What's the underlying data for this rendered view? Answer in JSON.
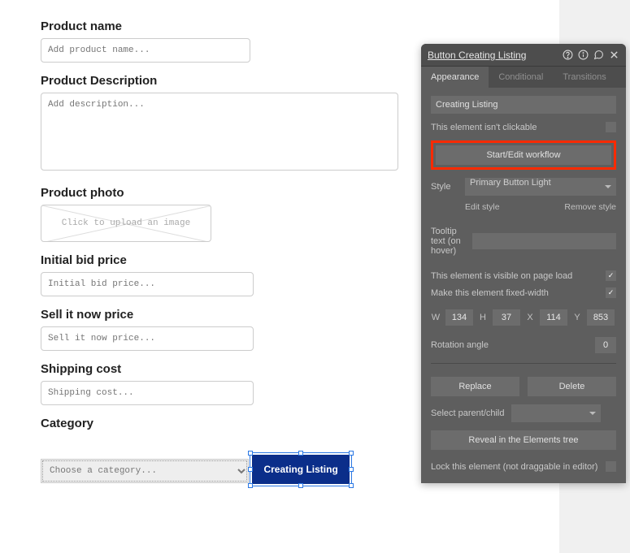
{
  "form": {
    "productName": {
      "label": "Product name",
      "placeholder": "Add product name..."
    },
    "productDescription": {
      "label": "Product Description",
      "placeholder": "Add description..."
    },
    "productPhoto": {
      "label": "Product photo",
      "text": "Click to upload an image"
    },
    "initialBid": {
      "label": "Initial bid price",
      "placeholder": "Initial bid price..."
    },
    "sellNow": {
      "label": "Sell it now price",
      "placeholder": "Sell it now price..."
    },
    "shipping": {
      "label": "Shipping cost",
      "placeholder": "Shipping cost..."
    },
    "category": {
      "label": "Category",
      "placeholder": "Choose a category..."
    },
    "createButton": "Creating Listing"
  },
  "panel": {
    "title": "Button Creating Listing",
    "tabs": {
      "appearance": "Appearance",
      "conditional": "Conditional",
      "transitions": "Transitions"
    },
    "elementName": "Creating Listing",
    "notClickable": "This element isn't clickable",
    "workflowBtn": "Start/Edit workflow",
    "styleLabel": "Style",
    "styleValue": "Primary Button Light",
    "editStyle": "Edit style",
    "removeStyle": "Remove style",
    "tooltipLabel": "Tooltip text (on hover)",
    "visibleLabel": "This element is visible on page load",
    "fixedWidthLabel": "Make this element fixed-width",
    "dims": {
      "W": "134",
      "H": "37",
      "X": "114",
      "Y": "853"
    },
    "rotationLabel": "Rotation angle",
    "rotationValue": "0",
    "replace": "Replace",
    "delete": "Delete",
    "selectParent": "Select parent/child",
    "reveal": "Reveal in the Elements tree",
    "lockLabel": "Lock this element (not draggable in editor)"
  }
}
